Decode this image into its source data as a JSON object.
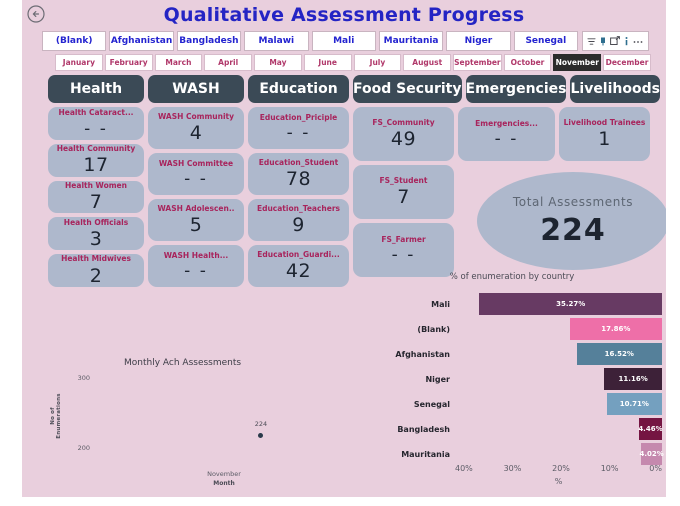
{
  "report": {
    "title": "Qualitative Assessment Progress",
    "background_color": "#e9cfdd",
    "title_color": "#2424c4"
  },
  "nav": {
    "back_icon": "back-arrow-icon"
  },
  "toolbar": {
    "icons": [
      "filter-icon",
      "pin-icon",
      "focus-mode-icon",
      "info-icon",
      "more-options-icon"
    ]
  },
  "country_slicer": {
    "items": [
      {
        "label": "(Blank)",
        "selected": false
      },
      {
        "label": "Afghanistan",
        "selected": false
      },
      {
        "label": "Bangladesh",
        "selected": false
      },
      {
        "label": "Malawi",
        "selected": false
      },
      {
        "label": "Mali",
        "selected": false
      },
      {
        "label": "Mauritania",
        "selected": false
      },
      {
        "label": "Niger",
        "selected": false
      },
      {
        "label": "Senegal",
        "selected": false
      }
    ]
  },
  "month_slicer": {
    "items": [
      {
        "label": "January",
        "selected": false
      },
      {
        "label": "February",
        "selected": false
      },
      {
        "label": "March",
        "selected": false
      },
      {
        "label": "April",
        "selected": false
      },
      {
        "label": "May",
        "selected": false
      },
      {
        "label": "June",
        "selected": false
      },
      {
        "label": "July",
        "selected": false
      },
      {
        "label": "August",
        "selected": false
      },
      {
        "label": "September",
        "selected": false
      },
      {
        "label": "October",
        "selected": false
      },
      {
        "label": "November",
        "selected": true
      },
      {
        "label": "December",
        "selected": false
      }
    ]
  },
  "sectors": [
    {
      "name": "Health",
      "cards": [
        {
          "label": "Health Cataract...",
          "value": "- -"
        },
        {
          "label": "Health Community",
          "value": "17"
        },
        {
          "label": "Health Women",
          "value": "7"
        },
        {
          "label": "Health Officials",
          "value": "3"
        },
        {
          "label": "Health Midwives",
          "value": "2"
        }
      ]
    },
    {
      "name": "WASH",
      "cards": [
        {
          "label": "WASH Community",
          "value": "4"
        },
        {
          "label": "WASH Committee",
          "value": "- -"
        },
        {
          "label": "WASH Adolescen..",
          "value": "5"
        },
        {
          "label": "WASH Health...",
          "value": "- -"
        }
      ]
    },
    {
      "name": "Education",
      "cards": [
        {
          "label": "Education_Priciple",
          "value": "- -"
        },
        {
          "label": "Education_Student",
          "value": "78"
        },
        {
          "label": "Education_Teachers",
          "value": "9"
        },
        {
          "label": "Education_Guardi...",
          "value": "42"
        }
      ]
    },
    {
      "name": "Food Security",
      "cards": [
        {
          "label": "FS_Community",
          "value": "49"
        },
        {
          "label": "FS_Student",
          "value": "7"
        },
        {
          "label": "FS_Farmer",
          "value": "- -"
        }
      ]
    },
    {
      "name": "Emergencies",
      "cards": [
        {
          "label": "Emergencies...",
          "value": "- -"
        }
      ]
    },
    {
      "name": "Livelihoods",
      "cards": [
        {
          "label": "Livelihood Trainees",
          "value": "1"
        }
      ]
    }
  ],
  "total_assessments": {
    "label": "Total Assessments",
    "value": "224"
  },
  "chart_data": [
    {
      "type": "bar",
      "id": "enumeration-by-country",
      "title": "% of enumeration by country",
      "orientation": "horizontal",
      "reversed_x_axis": true,
      "categories": [
        "Mali",
        "(Blank)",
        "Afghanistan",
        "Niger",
        "Senegal",
        "Bangladesh",
        "Mauritania"
      ],
      "values": [
        35.27,
        17.86,
        16.52,
        11.16,
        10.71,
        4.46,
        4.02
      ],
      "labels": [
        "35.27%",
        "17.86%",
        "16.52%",
        "11.16%",
        "10.71%",
        "4.46%",
        "4.02%"
      ],
      "colors": [
        "#673a63",
        "#ee6fa8",
        "#55809a",
        "#3d2138",
        "#74a0bf",
        "#751542",
        "#c589ae"
      ],
      "tick_labels": [
        "40%",
        "30%",
        "20%",
        "10%",
        "0%"
      ],
      "xlabel": "%",
      "ylabel": "",
      "xlim": [
        40,
        0
      ],
      "grid": false,
      "legend": "none"
    },
    {
      "type": "scatter",
      "id": "monthly-ach-assessments",
      "title": "Monthly Ach Assessments",
      "categories": [
        "November"
      ],
      "x": [
        "November"
      ],
      "values": [
        224
      ],
      "point_labels": [
        "224"
      ],
      "xlabel": "Month",
      "ylabel": "No of Enumerations",
      "ytick_labels": [
        "300",
        "200"
      ],
      "ylim": [
        150,
        320
      ],
      "point_color": "#2a3a4a",
      "grid": false,
      "legend": "none"
    }
  ]
}
